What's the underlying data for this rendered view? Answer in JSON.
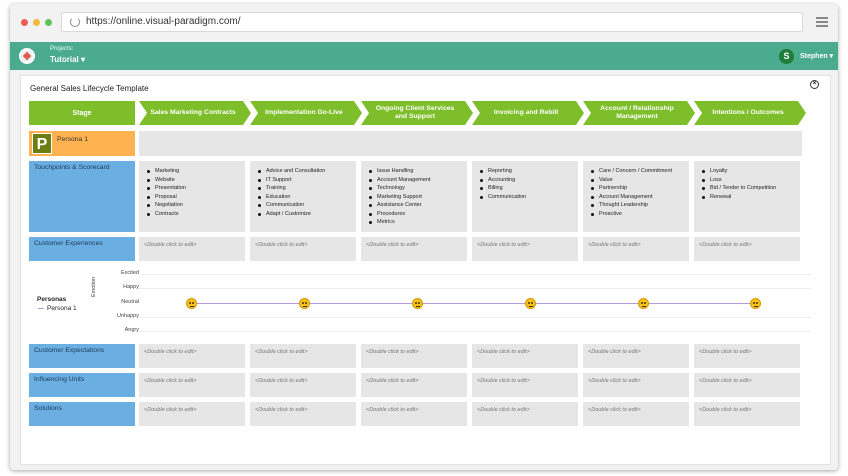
{
  "browser": {
    "url": "https://online.visual-paradigm.com/",
    "dot_colors": [
      "#ec5c4f",
      "#f4b83a",
      "#5fc254"
    ]
  },
  "appbar": {
    "projects_label": "Projects:",
    "project_name": "Tutorial ▾",
    "user_initial": "S",
    "user_name": "Stephen ▾",
    "accent": "#4aab8f"
  },
  "diagram": {
    "title": "General Sales Lifecycle Template",
    "stage_header": "Stage",
    "stages": [
      "Sales Marketing Contracts",
      "Implementation Go-Live",
      "Ongoing Client Services and Support",
      "Invoicing and Rebill",
      "Account / Relationship Management",
      "Intentions / Outcomes"
    ],
    "persona": {
      "initial": "P",
      "name": "Persona 1"
    },
    "rows": {
      "touchpoints": "Touchpoints & Scorecard",
      "experiences": "Customer Experiences",
      "expectations": "Customer Expectations",
      "influencing": "Influencing Units",
      "solutions": "Solutions"
    },
    "touchpoints": [
      [
        "Marketing",
        "Website",
        "Presentation",
        "Proposal",
        "Negotiation",
        "Contracts"
      ],
      [
        "Advice and Consultation",
        "IT Support",
        "Training",
        "Education",
        "Communication",
        "Adapt / Customize"
      ],
      [
        "Issue Handling",
        "Account Management",
        "Technology",
        "Marketing Support",
        "Assistance Center",
        "Procedures",
        "Metrics"
      ],
      [
        "Reporting",
        "Accounting",
        "Billing",
        "Communication"
      ],
      [
        "Care / Concern / Commitment",
        "Value",
        "Partnership",
        "Account Management",
        "Thought Leadership",
        "Proactive"
      ],
      [
        "Loyalty",
        "Loss",
        "Bid / Tender to Competition",
        "Renewal"
      ]
    ],
    "placeholder": "<Double click to edit>",
    "emotion": {
      "axis_label": "Emotion",
      "levels": [
        "Excited",
        "Happy",
        "Neutral",
        "Unhappy",
        "Angry"
      ],
      "legend_title": "Personas",
      "legend_item": "Persona 1",
      "values": [
        "Neutral",
        "Neutral",
        "Neutral",
        "Neutral",
        "Neutral",
        "Neutral"
      ]
    },
    "colors": {
      "stage": "#7dbe2a",
      "row_label": "#6aaee2",
      "persona": "#ffb24f"
    }
  }
}
